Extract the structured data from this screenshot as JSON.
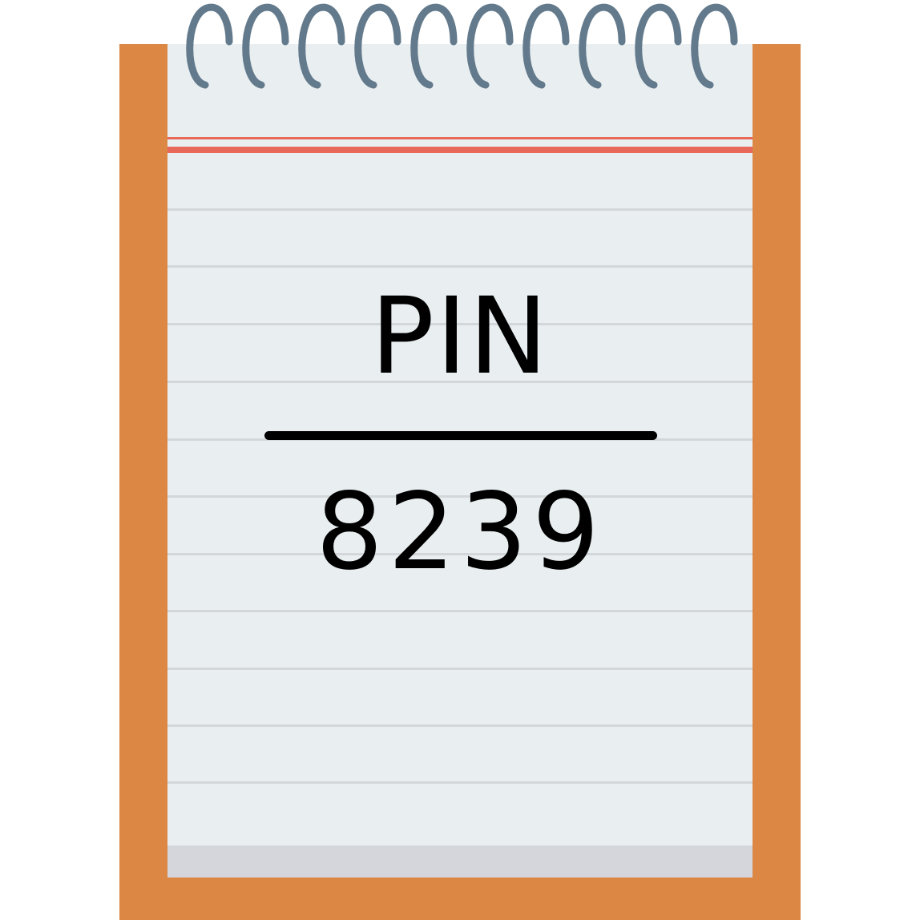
{
  "notepad": {
    "title": "PIN",
    "value": "8239"
  },
  "colors": {
    "cover": "#dc8744",
    "paper": "#e9eef1",
    "paper_bottom": "#d4d6db",
    "margin_rule": "#e8685a",
    "line_rule": "#d3d7da",
    "spiral": "#627a8c",
    "text": "#000000"
  },
  "icons": {
    "binding": "spiral-binding-icon"
  }
}
